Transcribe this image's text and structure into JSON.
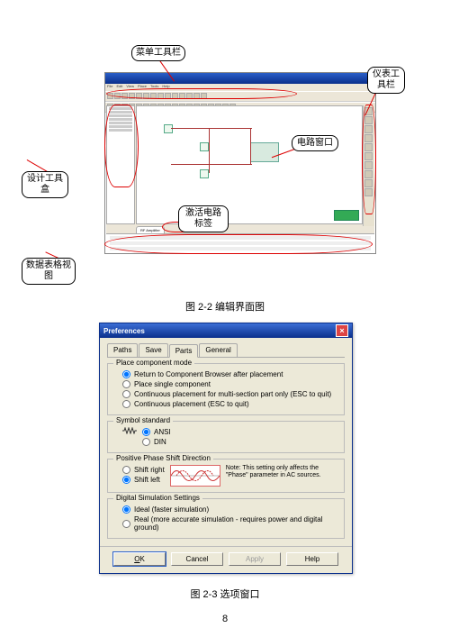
{
  "page_number": "8",
  "fig22": {
    "caption": "图 2-2  编辑界面图",
    "callouts": {
      "menu_bar": "菜单工具栏",
      "instrument_bar": "仪表工具栏",
      "design_toolbox": "设计工具盒",
      "circuit_window": "电路窗口",
      "active_tab": "激活电路标签",
      "spreadsheet_view": "数据表格视图"
    },
    "active_tab_label": "RF Amplifier"
  },
  "fig23": {
    "caption": "图 2-3  选项窗口",
    "title": "Preferences",
    "tabs": {
      "paths": "Paths",
      "save": "Save",
      "parts": "Parts",
      "general": "General"
    },
    "groups": {
      "place_mode": {
        "legend": "Place component mode",
        "opt_return": "Return to Component Browser after placement",
        "opt_single": "Place single component",
        "opt_multi": "Continuous placement for multi-section part only (ESC to quit)",
        "opt_cont": "Continuous placement (ESC to quit)"
      },
      "symbol_std": {
        "legend": "Symbol standard",
        "opt_ansi": "ANSI",
        "opt_din": "DIN"
      },
      "phase": {
        "legend": "Positive Phase Shift Direction",
        "opt_right": "Shift right",
        "opt_left": "Shift left",
        "note": "Note: This setting only affects the \"Phase\" parameter in AC sources."
      },
      "digital": {
        "legend": "Digital Simulation Settings",
        "opt_ideal": "Ideal (faster simulation)",
        "opt_real": "Real (more accurate simulation - requires power and digital ground)"
      }
    },
    "buttons": {
      "ok": "OK",
      "cancel": "Cancel",
      "apply": "Apply",
      "help": "Help"
    }
  }
}
